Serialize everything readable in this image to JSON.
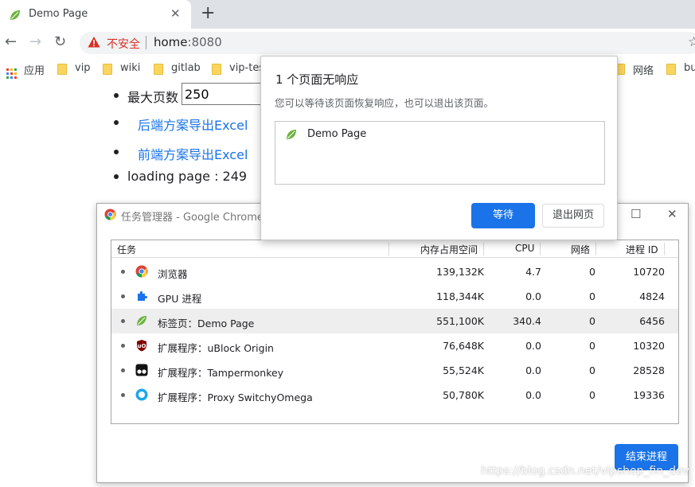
{
  "browser": {
    "tab": {
      "title": "Demo Page",
      "close": "✕"
    },
    "new_tab": "+",
    "nav": {
      "back": "←",
      "forward": "→",
      "reload": "↻"
    },
    "omnibox": {
      "security_label": "不安全",
      "host": "home",
      "port": ":8080"
    },
    "bookmarks": [
      {
        "label": "应用"
      },
      {
        "label": "vip"
      },
      {
        "label": "wiki"
      },
      {
        "label": "gitlab"
      },
      {
        "label": "vip-tes"
      },
      {
        "label": "网络"
      },
      {
        "label": "bu"
      }
    ]
  },
  "page": {
    "max_pages_label": "最大页数",
    "max_pages_value": "250",
    "backend_export_link": "后端方案导出Excel",
    "frontend_export_link": "前端方案导出Excel",
    "loading_text": "loading page : 249"
  },
  "task_manager": {
    "title": "任务管理器 - Google Chrome",
    "columns": [
      "任务",
      "内存占用空间",
      "CPU",
      "网络",
      "进程 ID"
    ],
    "rows": [
      {
        "name": "浏览器",
        "memory": "139,132K",
        "cpu": "4.7",
        "network": "0",
        "pid": "10720",
        "icon": "chrome-icon",
        "selected": false
      },
      {
        "name": "GPU 进程",
        "memory": "118,344K",
        "cpu": "0.0",
        "network": "0",
        "pid": "4824",
        "icon": "puzzle-icon",
        "selected": false
      },
      {
        "name": "标签页：Demo Page",
        "memory": "551,100K",
        "cpu": "340.4",
        "network": "0",
        "pid": "6456",
        "icon": "leaf-icon",
        "selected": true
      },
      {
        "name": "扩展程序：uBlock Origin",
        "memory": "76,648K",
        "cpu": "0.0",
        "network": "0",
        "pid": "10320",
        "icon": "ublock-icon",
        "selected": false
      },
      {
        "name": "扩展程序：Tampermonkey",
        "memory": "55,524K",
        "cpu": "0.0",
        "network": "0",
        "pid": "28528",
        "icon": "tampermonkey-icon",
        "selected": false
      },
      {
        "name": "扩展程序：Proxy SwitchyOmega",
        "memory": "50,780K",
        "cpu": "0.0",
        "network": "0",
        "pid": "19336",
        "icon": "switchyomega-icon",
        "selected": false
      }
    ],
    "end_process_button": "结束进程"
  },
  "dialog": {
    "heading": "1 个页面无响应",
    "message": "您可以等待该页面恢复响应，也可以退出该页面。",
    "page_item": "Demo Page",
    "wait_button": "等待",
    "exit_button": "退出网页"
  },
  "watermark": "https://blog.csdn.net/vipshop_fin_dev",
  "colors": {
    "accent": "#1a73e8",
    "insecure_red": "#d93025",
    "leaf_green": "#6cb33f"
  }
}
